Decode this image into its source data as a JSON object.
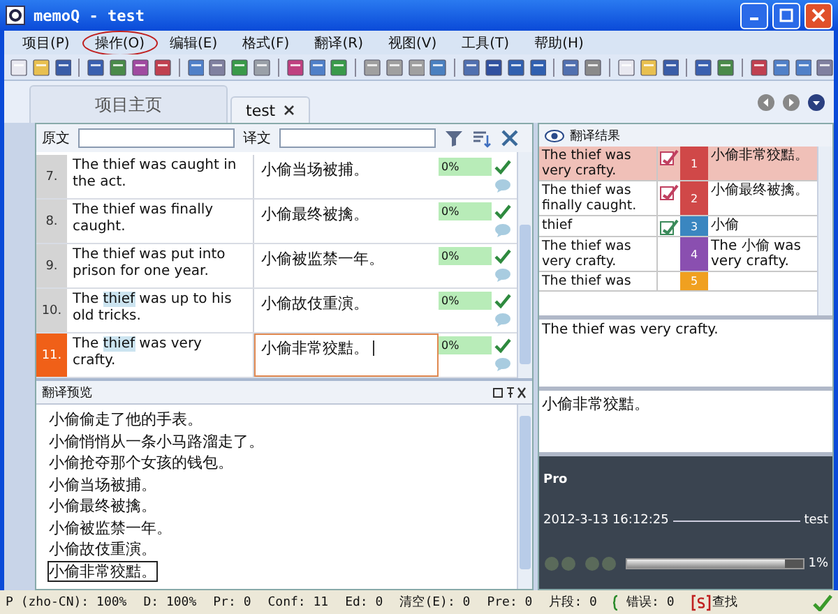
{
  "window": {
    "title": "memoQ - test"
  },
  "menu": [
    {
      "label": "项目(P)",
      "highlighted": false
    },
    {
      "label": "操作(O)",
      "highlighted": true
    },
    {
      "label": "编辑(E)",
      "highlighted": false
    },
    {
      "label": "格式(F)",
      "highlighted": false
    },
    {
      "label": "翻译(R)",
      "highlighted": false
    },
    {
      "label": "视图(V)",
      "highlighted": false
    },
    {
      "label": "工具(T)",
      "highlighted": false
    },
    {
      "label": "帮助(H)",
      "highlighted": false
    }
  ],
  "tabs": [
    {
      "label": "项目主页",
      "selected": false,
      "closable": false
    },
    {
      "label": "test",
      "selected": true,
      "closable": true
    }
  ],
  "filter": {
    "source_label": "原文",
    "target_label": "译文"
  },
  "rows": [
    {
      "number": "7.",
      "selected": false,
      "source": [
        {
          "text": "The thief was caught in the act.",
          "term": false
        }
      ],
      "target": "小偷当场被捕。",
      "match": "0%",
      "confirmed": true
    },
    {
      "number": "8.",
      "selected": false,
      "source": [
        {
          "text": "The thief was finally caught.",
          "term": false
        }
      ],
      "target": "小偷最终被擒。",
      "match": "0%",
      "confirmed": true
    },
    {
      "number": "9.",
      "selected": false,
      "source": [
        {
          "text": "The thief was put into prison for one year.",
          "term": false
        }
      ],
      "target": "小偷被监禁一年。",
      "match": "0%",
      "confirmed": true
    },
    {
      "number": "10.",
      "selected": false,
      "source": [
        {
          "text": "The ",
          "term": false
        },
        {
          "text": "thief",
          "term": true
        },
        {
          "text": " was up to his old tricks.",
          "term": false
        }
      ],
      "target": "小偷故伎重演。",
      "match": "0%",
      "confirmed": true
    },
    {
      "number": "11.",
      "selected": true,
      "source": [
        {
          "text": "The ",
          "term": false
        },
        {
          "text": "thief",
          "term": true
        },
        {
          "text": " was very crafty.",
          "term": false
        }
      ],
      "target": "小偷非常狡黠。",
      "match": "0%",
      "confirmed": true
    }
  ],
  "preview": {
    "title": "翻译预览",
    "lines": [
      {
        "text": "小偷偷走了他的手表。",
        "selected": false
      },
      {
        "text": "小偷悄悄从一条小马路溜走了。",
        "selected": false
      },
      {
        "text": "小偷抢夺那个女孩的钱包。",
        "selected": false
      },
      {
        "text": "小偷当场被捕。",
        "selected": false
      },
      {
        "text": "小偷最终被擒。",
        "selected": false
      },
      {
        "text": "小偷被监禁一年。",
        "selected": false
      },
      {
        "text": "小偷故伎重演。",
        "selected": false
      },
      {
        "text": "小偷非常狡黠。",
        "selected": true
      }
    ]
  },
  "results": {
    "title": "翻译结果",
    "items": [
      {
        "source": "The thief was very crafty.",
        "kind": "tm",
        "number": "1",
        "color": "#d04848",
        "target": "小偷非常狡黠。",
        "selected": true
      },
      {
        "source": "The thief was finally caught.",
        "kind": "tm",
        "number": "2",
        "color": "#d04848",
        "target": "小偷最终被擒。",
        "selected": false
      },
      {
        "source": "thief",
        "kind": "term",
        "number": "3",
        "color": "#3a86c0",
        "target": "小偷",
        "selected": false
      },
      {
        "source": "The thief was very crafty.",
        "kind": "none",
        "number": "4",
        "color": "#8a4fb0",
        "target": "The 小偷 was very crafty.",
        "selected": false
      },
      {
        "source": "The thief was",
        "kind": "none",
        "number": "5",
        "color": "#f0a020",
        "selected": false
      }
    ]
  },
  "source_view": "The thief was very crafty.",
  "target_view": "小偷非常狡黠。",
  "pro": {
    "title": "Pro",
    "date": "2012-3-13 16:12:25",
    "user": "test",
    "percent": "1%",
    "level": 0.9
  },
  "status_bar": [
    {
      "text": "P (zho-CN): 100%",
      "kind": "text"
    },
    {
      "text": "D: 100%",
      "kind": "text"
    },
    {
      "text": "Pr: 0",
      "kind": "text"
    },
    {
      "text": "Conf: 11",
      "kind": "text"
    },
    {
      "text": "Ed: 0",
      "kind": "text"
    },
    {
      "text": "清空(E): 0",
      "kind": "text"
    },
    {
      "text": "Pre: 0",
      "kind": "text"
    },
    {
      "text": "片段: 0",
      "kind": "text"
    },
    {
      "text": "错误: 0",
      "kind": "errors"
    },
    {
      "text": "查找",
      "kind": "find"
    }
  ]
}
